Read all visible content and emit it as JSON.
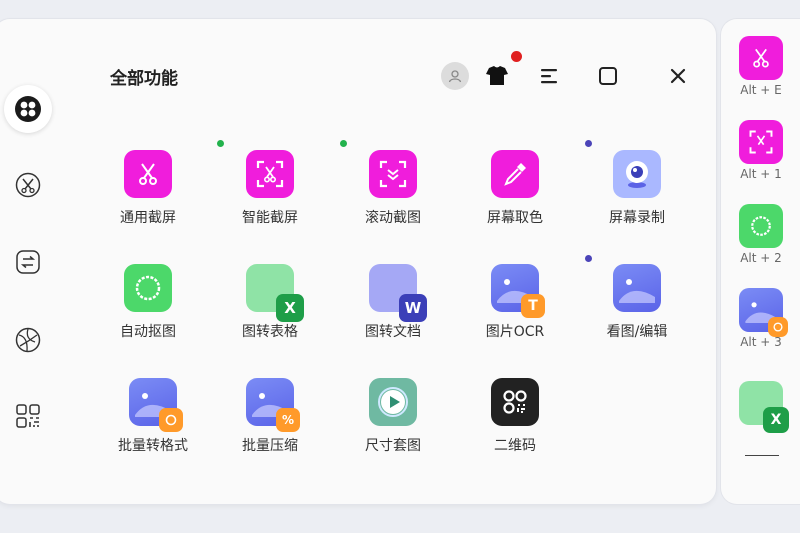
{
  "header": {
    "title": "全部功能"
  },
  "colors": {
    "magenta": "#f01ddc",
    "green": "#4cd86a",
    "indigo": "#6a6ef2",
    "orange": "#ff9a2a",
    "dark": "#222222",
    "excel": "#1e9e48"
  },
  "dots": {
    "green": "#22b24c",
    "purple": "#4b44b8"
  },
  "icons": {
    "header": [
      "avatar-icon",
      "skin-icon",
      "menu-icon",
      "maximize-icon",
      "close-icon"
    ],
    "rail": [
      "apps-grid-icon",
      "scissors-icon",
      "convert-icon",
      "aperture-icon",
      "qr-code-icon"
    ]
  },
  "tools": [
    {
      "label": "通用截屏",
      "icon": "scissors-icon"
    },
    {
      "label": "智能截屏",
      "icon": "smart-capture-icon"
    },
    {
      "label": "滚动截图",
      "icon": "scroll-capture-icon"
    },
    {
      "label": "屏幕取色",
      "icon": "color-picker-icon"
    },
    {
      "label": "屏幕录制",
      "icon": "webcam-icon"
    },
    {
      "label": "自动抠图",
      "icon": "cutout-icon"
    },
    {
      "label": "图转表格",
      "icon": "image-to-excel-icon"
    },
    {
      "label": "图转文档",
      "icon": "image-to-word-icon"
    },
    {
      "label": "图片OCR",
      "icon": "ocr-icon"
    },
    {
      "label": "看图/编辑",
      "icon": "image-viewer-icon"
    },
    {
      "label": "批量转格式",
      "icon": "batch-convert-icon"
    },
    {
      "label": "批量压缩",
      "icon": "batch-compress-icon"
    },
    {
      "label": "尺寸套图",
      "icon": "size-template-icon"
    },
    {
      "label": "二维码",
      "icon": "qr-code-icon"
    }
  ],
  "shortcuts": [
    {
      "label": "Alt + E",
      "icon": "scissors-icon"
    },
    {
      "label": "Alt + 1",
      "icon": "smart-capture-icon"
    },
    {
      "label": "Alt + 2",
      "icon": "cutout-icon"
    },
    {
      "label": "Alt + 3",
      "icon": "batch-convert-icon"
    },
    {
      "label": "",
      "icon": "image-to-excel-icon"
    }
  ]
}
